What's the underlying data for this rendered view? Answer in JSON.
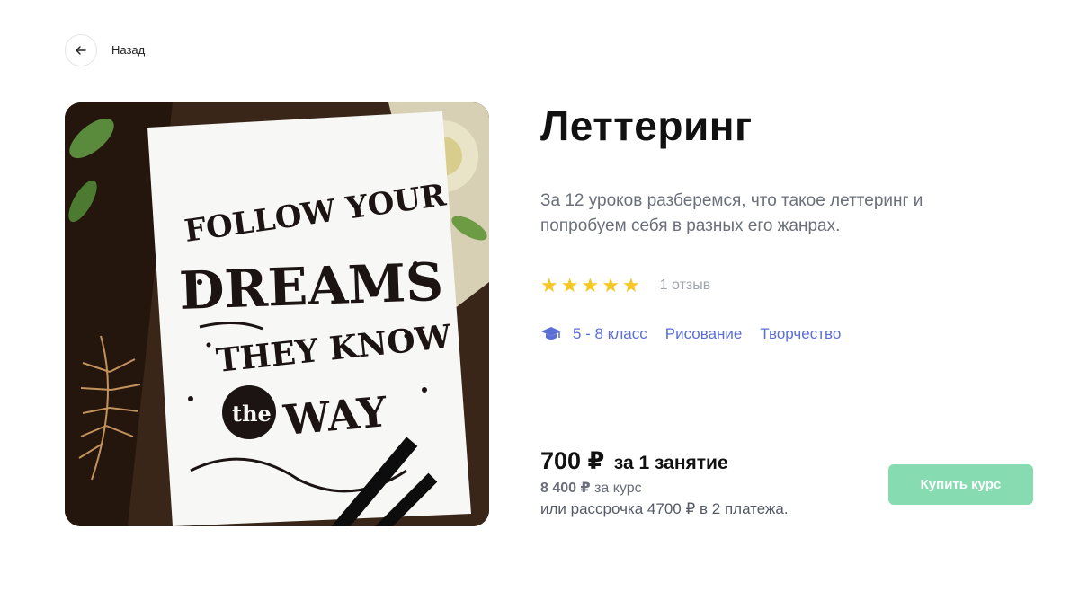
{
  "nav": {
    "back_label": "Назад"
  },
  "course": {
    "title": "Леттеринг",
    "description": "За 12 уроков разберемся, что такое леттеринг и попробуем себя в разных его жанрах.",
    "rating": {
      "stars": 5,
      "reviews": "1 отзыв"
    },
    "tags": [
      "5 - 8 класс",
      "Рисование",
      "Творчество"
    ],
    "image_text": [
      "FOLLOW YOUR",
      "DREAMS",
      "THEY KNOW",
      "the",
      "WAY"
    ]
  },
  "pricing": {
    "price": "700 ₽",
    "price_unit": "за 1 занятие",
    "total": "8 400 ₽",
    "total_unit": "за курс",
    "installment": "или рассрочка 4700 ₽ в 2 платежа."
  },
  "actions": {
    "buy_label": "Купить курс"
  },
  "colors": {
    "accent": "#5b6fd6",
    "star": "#f6c624",
    "buy_button": "#86dbb0"
  },
  "icons": [
    "arrow-left-icon",
    "star-icon",
    "graduation-cap-icon"
  ]
}
